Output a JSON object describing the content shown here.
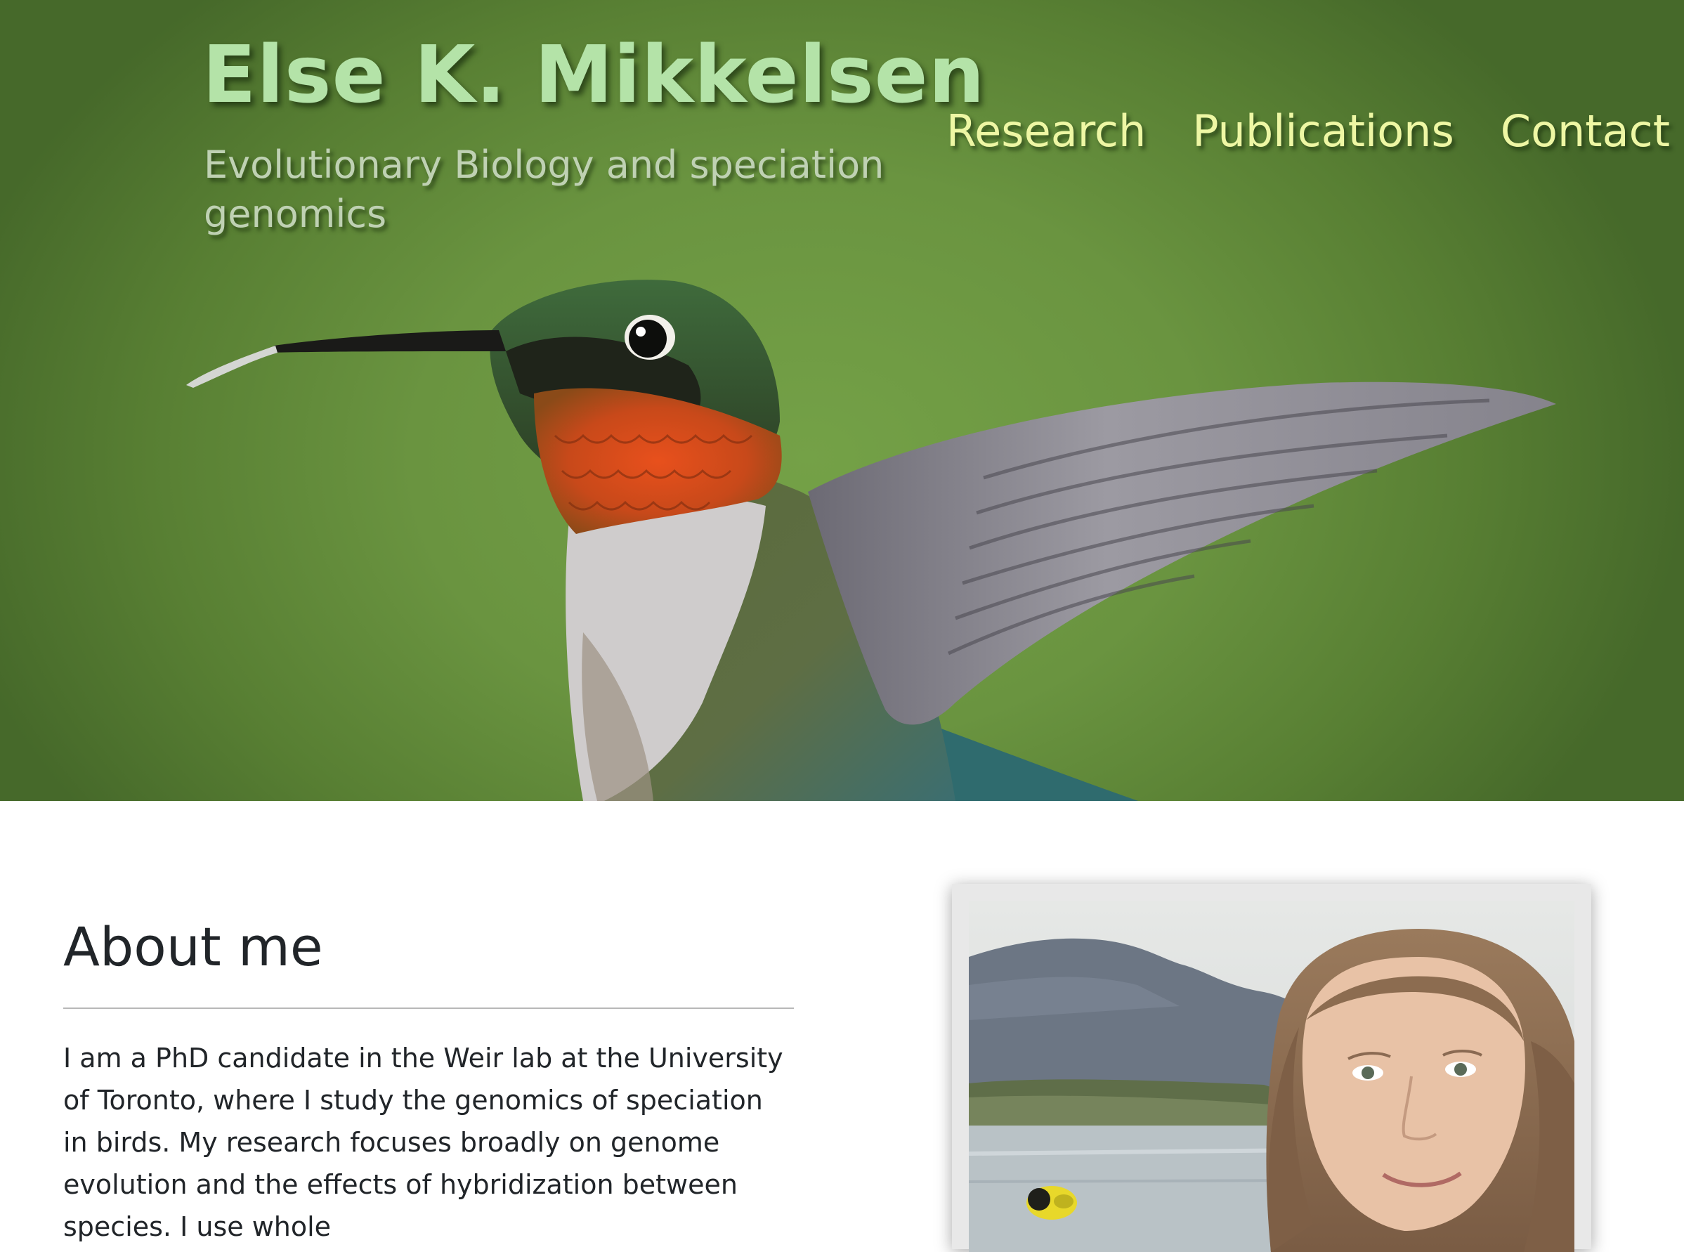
{
  "site": {
    "name": "Else K. Mikkelsen",
    "subtitle": "Evolutionary Biology and speciation genomics"
  },
  "nav": {
    "items": [
      {
        "label": "Research"
      },
      {
        "label": "Publications"
      },
      {
        "label": "Contact"
      }
    ]
  },
  "hero_image": {
    "subject": "hummingbird",
    "background_color": "#6a9440"
  },
  "about": {
    "heading": "About me",
    "body": "I am a PhD candidate in the Weir lab at the University of Toronto, where I study the genomics of speciation in birds. My research focuses broadly on genome evolution and the effects of hybridization between species. I use whole"
  },
  "profile_photo": {
    "subject": "portrait with yellow bird and mountain lake"
  },
  "colors": {
    "title": "#b4e3a8",
    "subtitle": "#bfd1b3",
    "nav_link": "#eef7a4",
    "body_text": "#212529"
  }
}
